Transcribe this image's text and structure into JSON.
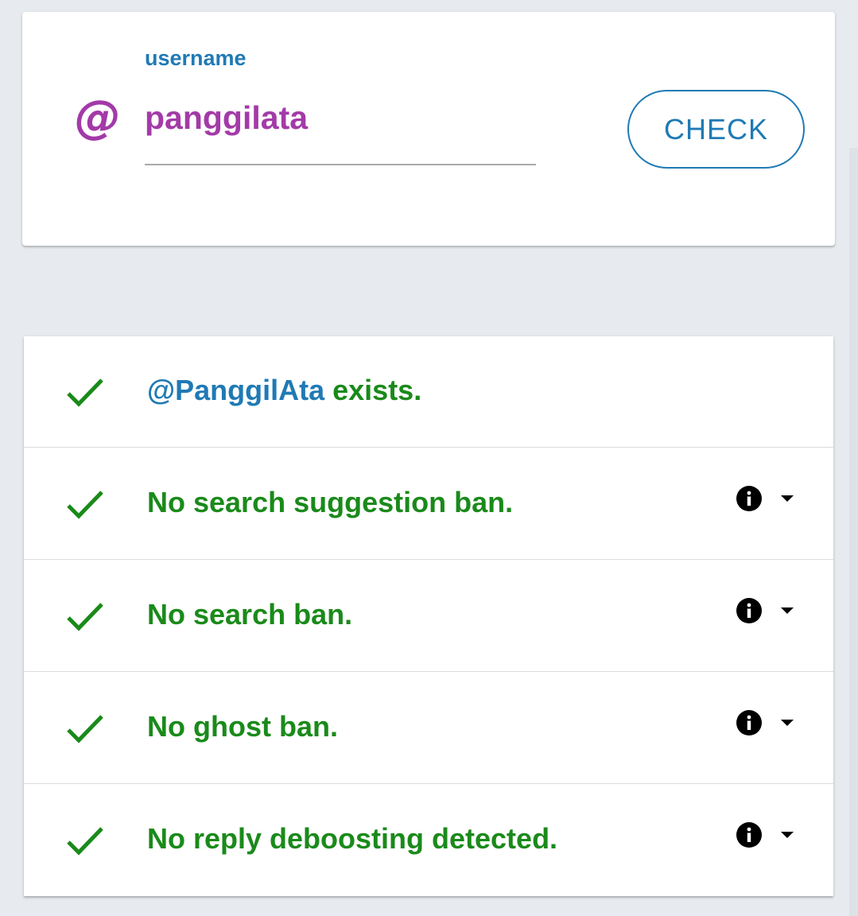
{
  "colors": {
    "accent_blue": "#1f7ab5",
    "username_purple": "#a33aa8",
    "success_green": "#1a8a1a",
    "icon_black": "#000000"
  },
  "search": {
    "at_symbol": "@",
    "label": "username",
    "value": "panggilata",
    "button_label": "CHECK"
  },
  "results": [
    {
      "status_icon": "check-icon",
      "handle": "@PanggilAta",
      "text": " exists.",
      "has_info": false
    },
    {
      "status_icon": "check-icon",
      "handle": "",
      "text": "No search suggestion ban.",
      "has_info": true,
      "info_icon": "info-icon",
      "expand_icon": "caret-down-icon"
    },
    {
      "status_icon": "check-icon",
      "handle": "",
      "text": "No search ban.",
      "has_info": true,
      "info_icon": "info-icon",
      "expand_icon": "caret-down-icon"
    },
    {
      "status_icon": "check-icon",
      "handle": "",
      "text": "No ghost ban.",
      "has_info": true,
      "info_icon": "info-icon",
      "expand_icon": "caret-down-icon"
    },
    {
      "status_icon": "check-icon",
      "handle": "",
      "text": "No reply deboosting detected.",
      "has_info": true,
      "info_icon": "info-icon",
      "expand_icon": "caret-down-icon"
    }
  ]
}
